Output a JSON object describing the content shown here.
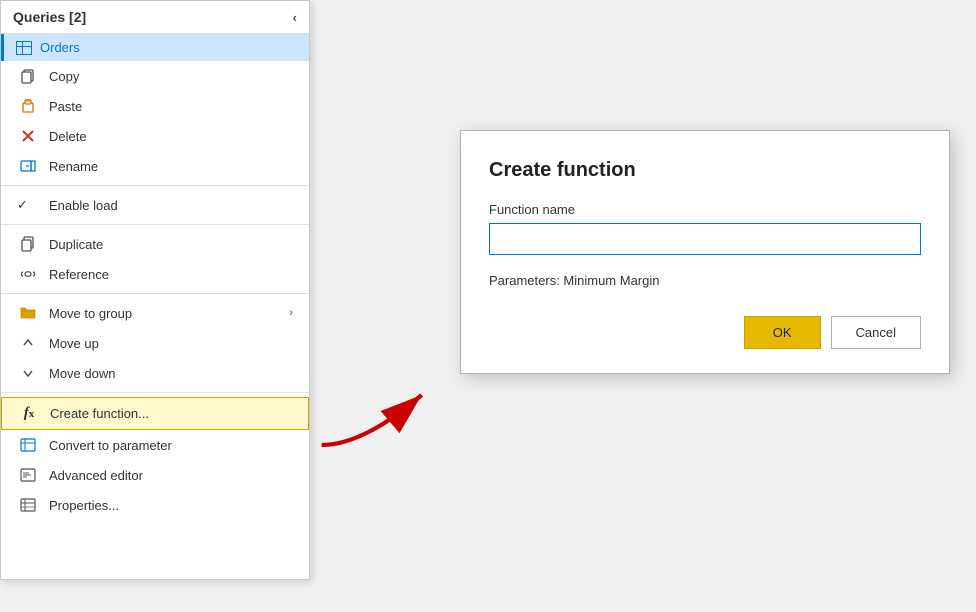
{
  "panel": {
    "title": "Queries [2]",
    "collapse_label": "‹",
    "selected_item": "Orders"
  },
  "menu_items": [
    {
      "id": "copy",
      "label": "Copy",
      "icon": "copy",
      "type": "item"
    },
    {
      "id": "paste",
      "label": "Paste",
      "icon": "paste",
      "type": "item"
    },
    {
      "id": "delete",
      "label": "Delete",
      "icon": "delete",
      "type": "item"
    },
    {
      "id": "rename",
      "label": "Rename",
      "icon": "rename",
      "type": "item"
    },
    {
      "id": "divider1",
      "type": "divider"
    },
    {
      "id": "enableload",
      "label": "Enable load",
      "icon": "check",
      "type": "check",
      "checked": true
    },
    {
      "id": "divider2",
      "type": "divider"
    },
    {
      "id": "duplicate",
      "label": "Duplicate",
      "icon": "duplicate",
      "type": "item"
    },
    {
      "id": "reference",
      "label": "Reference",
      "icon": "reference",
      "type": "item"
    },
    {
      "id": "divider3",
      "type": "divider"
    },
    {
      "id": "movetogroup",
      "label": "Move to group",
      "icon": "folder",
      "type": "item",
      "hasSubmenu": true
    },
    {
      "id": "moveup",
      "label": "Move up",
      "icon": "moveup",
      "type": "item"
    },
    {
      "id": "movedown",
      "label": "Move down",
      "icon": "movedown",
      "type": "item"
    },
    {
      "id": "divider4",
      "type": "divider"
    },
    {
      "id": "createfunction",
      "label": "Create function...",
      "icon": "fx",
      "type": "item",
      "highlighted": true
    },
    {
      "id": "convertparam",
      "label": "Convert to parameter",
      "icon": "convert",
      "type": "item"
    },
    {
      "id": "advancededitor",
      "label": "Advanced editor",
      "icon": "editor",
      "type": "item"
    },
    {
      "id": "properties",
      "label": "Properties...",
      "icon": "props",
      "type": "item"
    }
  ],
  "dialog": {
    "title": "Create function",
    "function_name_label": "Function name",
    "function_name_placeholder": "",
    "parameters_label": "Parameters: Minimum Margin",
    "ok_label": "OK",
    "cancel_label": "Cancel"
  },
  "colors": {
    "selected_bg": "#cce5ff",
    "selected_border": "#0078d4",
    "ok_bg": "#e6b800",
    "highlight_bg": "#fff8cc"
  }
}
